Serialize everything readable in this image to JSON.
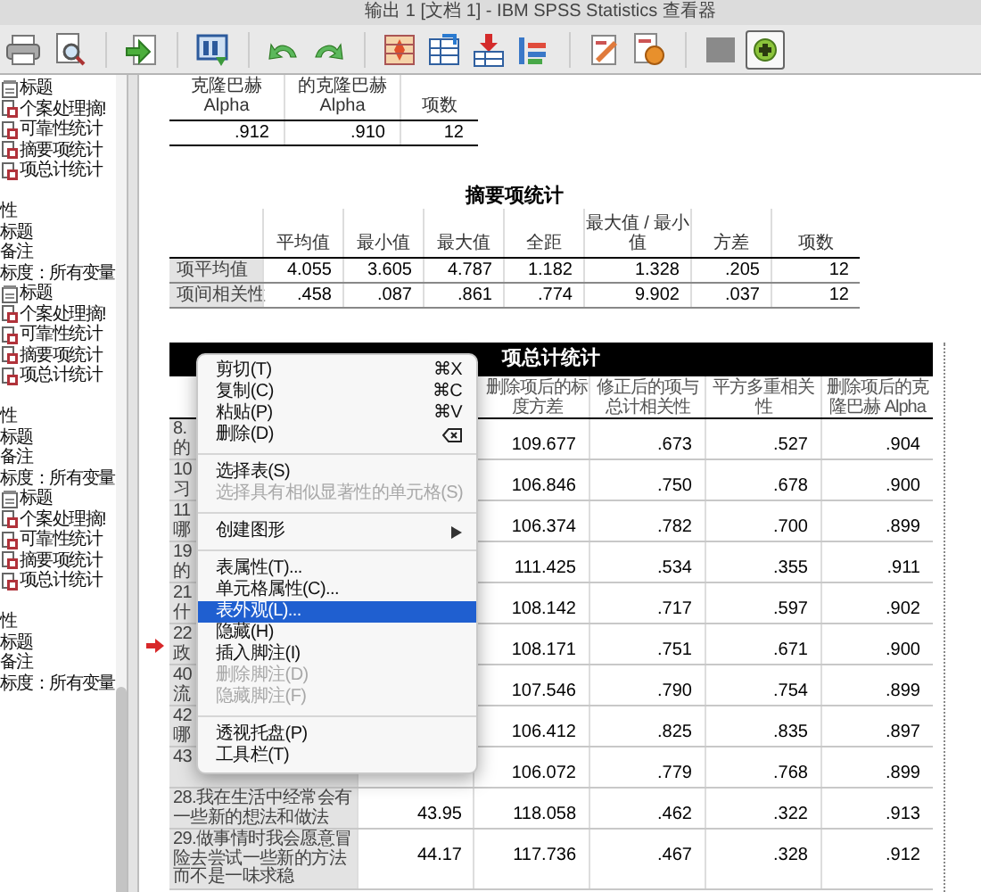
{
  "window": {
    "title": "输出 1 [文档 1] - IBM SPSS Statistics 查看器"
  },
  "outline": [
    {
      "children": [
        {
          "label": "标题",
          "kind": "title"
        },
        {
          "label": "个案处理摘!",
          "kind": "table"
        },
        {
          "label": "可靠性统计",
          "kind": "table"
        },
        {
          "label": "摘要项统计",
          "kind": "table"
        },
        {
          "label": "项总计统计",
          "kind": "table"
        }
      ]
    },
    {
      "label": "性",
      "children": [
        {
          "label": "标题"
        },
        {
          "label": "备注"
        },
        {
          "label": "标度：所有变量",
          "children": [
            {
              "label": "标题",
              "kind": "title"
            },
            {
              "label": "个案处理摘!",
              "kind": "table"
            },
            {
              "label": "可靠性统计",
              "kind": "table"
            },
            {
              "label": "摘要项统计",
              "kind": "table"
            },
            {
              "label": "项总计统计",
              "kind": "table"
            }
          ]
        }
      ]
    },
    {
      "label": "性",
      "children": [
        {
          "label": "标题"
        },
        {
          "label": "备注"
        },
        {
          "label": "标度：所有变量",
          "children": [
            {
              "label": "标题",
              "kind": "title"
            },
            {
              "label": "个案处理摘!",
              "kind": "table"
            },
            {
              "label": "可靠性统计",
              "kind": "table"
            },
            {
              "label": "摘要项统计",
              "kind": "table"
            },
            {
              "label": "项总计统计",
              "kind": "table"
            }
          ]
        }
      ]
    },
    {
      "label": "性",
      "children": [
        {
          "label": "标题"
        },
        {
          "label": "备注"
        },
        {
          "label": "标度：所有变量"
        }
      ]
    }
  ],
  "reliability_table": {
    "columns": [
      [
        "克隆巴赫",
        "Alpha"
      ],
      [
        "的克隆巴赫",
        "Alpha"
      ],
      [
        "项数"
      ]
    ],
    "values": [
      ".912",
      ".910",
      "12"
    ]
  },
  "summary_table": {
    "title": "摘要项统计",
    "columns": [
      "平均值",
      "最小值",
      "最大值",
      "全距",
      "最大值 / 最小值",
      "方差",
      "项数"
    ],
    "rows": [
      {
        "label": "项平均值",
        "values": [
          "4.055",
          "3.605",
          "4.787",
          "1.182",
          "1.328",
          ".205",
          "12"
        ]
      },
      {
        "label": "项间相关性",
        "values": [
          ".458",
          ".087",
          ".861",
          ".774",
          "9.902",
          ".037",
          "12"
        ]
      }
    ]
  },
  "item_total_table": {
    "title": "项总计统计",
    "columns": [
      "删除项后的标度方差",
      "修正后的项与总计相关性",
      "平方多重相关性",
      "删除项后的克隆巴赫 Alpha"
    ],
    "rows": [
      {
        "label_lines": [
          "8.",
          "的"
        ],
        "marked": false,
        "values": [
          "109.677",
          ".673",
          ".527",
          ".904"
        ]
      },
      {
        "label_lines": [
          "10",
          "习"
        ],
        "marked": false,
        "values": [
          "106.846",
          ".750",
          ".678",
          ".900"
        ]
      },
      {
        "label_lines": [
          "11",
          "哪"
        ],
        "marked": false,
        "values": [
          "106.374",
          ".782",
          ".700",
          ".899"
        ]
      },
      {
        "label_lines": [
          "19",
          "的"
        ],
        "marked": false,
        "values": [
          "111.425",
          ".534",
          ".355",
          ".911"
        ]
      },
      {
        "label_lines": [
          "21",
          "什"
        ],
        "marked": false,
        "values": [
          "108.142",
          ".717",
          ".597",
          ".902"
        ]
      },
      {
        "label_lines": [
          "22",
          "政"
        ],
        "marked": true,
        "values": [
          "108.171",
          ".751",
          ".671",
          ".900"
        ]
      },
      {
        "label_lines": [
          "40",
          "流"
        ],
        "marked": false,
        "values": [
          "107.546",
          ".790",
          ".754",
          ".899"
        ]
      },
      {
        "label_lines": [
          "42",
          "哪"
        ],
        "marked": false,
        "values": [
          "106.412",
          ".825",
          ".835",
          ".897"
        ]
      },
      {
        "label_lines": [
          "43"
        ],
        "marked": false,
        "values": [
          "106.072",
          ".779",
          ".768",
          ".899"
        ]
      },
      {
        "label": "28.我在生活中经常会有一些新的想法和做法",
        "marked": false,
        "scale_mean": "43.95",
        "values": [
          "118.058",
          ".462",
          ".322",
          ".913"
        ]
      },
      {
        "label": "29.做事情时我会愿意冒险去尝试一些新的方法而不是一味求稳",
        "marked": false,
        "scale_mean": "44.17",
        "values": [
          "117.736",
          ".467",
          ".328",
          ".912"
        ]
      }
    ]
  },
  "context_menu": [
    {
      "kind": "item",
      "label": "剪切(T)",
      "shortcut": "⌘X",
      "disabled": false,
      "selected": false
    },
    {
      "kind": "item",
      "label": "复制(C)",
      "shortcut": "⌘C",
      "disabled": false,
      "selected": false
    },
    {
      "kind": "item",
      "label": "粘贴(P)",
      "shortcut": "⌘V",
      "disabled": false,
      "selected": false
    },
    {
      "kind": "delete_key",
      "label": "删除(D)",
      "disabled": false,
      "selected": false
    },
    {
      "kind": "separator"
    },
    {
      "kind": "item",
      "label": "选择表(S)",
      "disabled": false,
      "selected": false
    },
    {
      "kind": "item",
      "label": "选择具有相似显著性的单元格(S)",
      "disabled": true,
      "selected": false
    },
    {
      "kind": "separator"
    },
    {
      "kind": "submenu",
      "label": "创建图形",
      "disabled": false,
      "selected": false
    },
    {
      "kind": "separator"
    },
    {
      "kind": "item",
      "label": "表属性(T)...",
      "disabled": false,
      "selected": false
    },
    {
      "kind": "item",
      "label": "单元格属性(C)...",
      "disabled": false,
      "selected": false
    },
    {
      "kind": "item",
      "label": "表外观(L)...",
      "disabled": false,
      "selected": true
    },
    {
      "kind": "item",
      "label": "隐藏(H)",
      "disabled": false,
      "selected": false
    },
    {
      "kind": "item",
      "label": "插入脚注(I)",
      "disabled": false,
      "selected": false
    },
    {
      "kind": "item",
      "label": "删除脚注(D)",
      "disabled": true,
      "selected": false
    },
    {
      "kind": "item",
      "label": "隐藏脚注(F)",
      "disabled": true,
      "selected": false
    },
    {
      "kind": "separator"
    },
    {
      "kind": "item",
      "label": "透视托盘(P)",
      "disabled": false,
      "selected": false
    },
    {
      "kind": "item",
      "label": "工具栏(T)",
      "disabled": false,
      "selected": false
    }
  ]
}
